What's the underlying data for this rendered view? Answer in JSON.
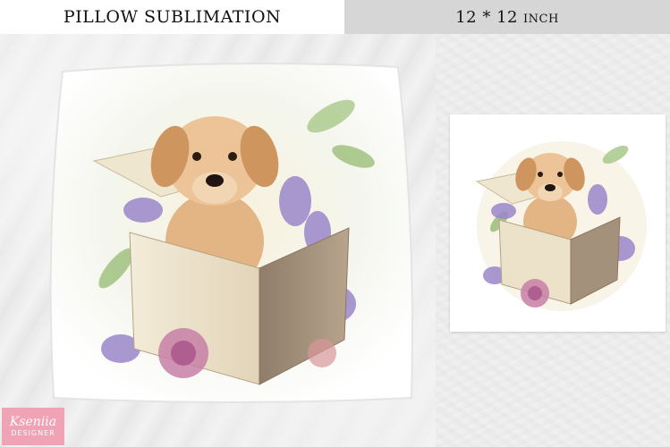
{
  "banner": {
    "left_title": "PILLOW SUBLIMATION",
    "right_size": "12 * 12",
    "right_unit": "inch"
  },
  "logo": {
    "name": "Kseniia",
    "tag": "DESIGNER"
  },
  "colors": {
    "banner_left_bg": "#ffffff",
    "banner_right_bg": "#d6d6d6",
    "logo_bg": "#f0a3b4",
    "puppy_fur": "#e7b98a",
    "flowers_purple": "#9a86c9",
    "flowers_pink": "#c77fa6",
    "leaves_green": "#9bbf7a"
  }
}
